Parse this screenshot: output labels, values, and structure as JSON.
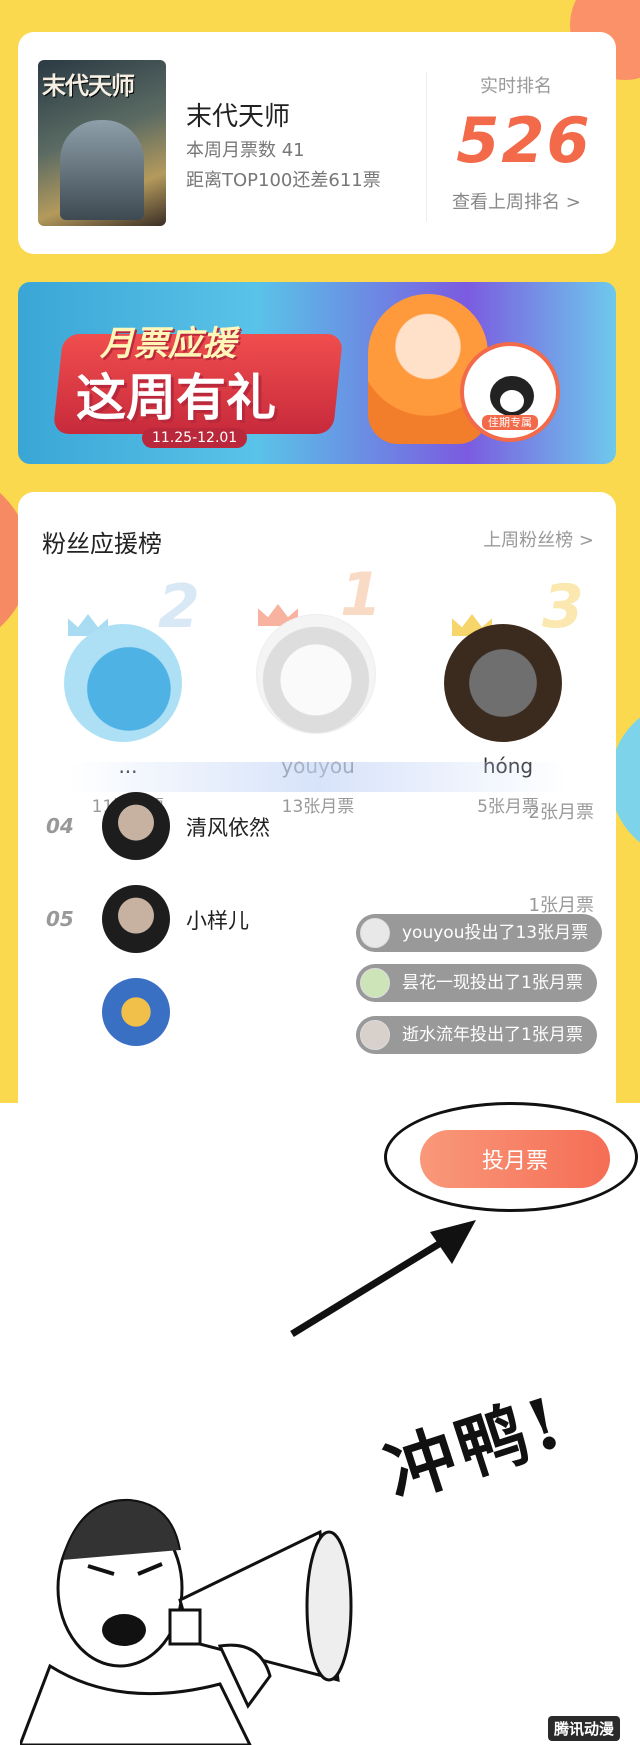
{
  "rank_card": {
    "comic_title": "末代天师",
    "weekly_votes": "本周月票数 41",
    "gap_text": "距离TOP100还差611票",
    "realtime_label": "实时排名",
    "rank_number": "526",
    "last_week_link": "查看上周排名 >",
    "cover_title": "末代天师"
  },
  "banner": {
    "line1": "月票应援",
    "line2": "这周有礼",
    "date_range": "11.25-12.01",
    "badge_text": "佳期专属"
  },
  "fan_board": {
    "title": "粉丝应援榜",
    "last_week_link": "上周粉丝榜 >",
    "podium": [
      {
        "rank": "2",
        "name": "...",
        "votes": "11张月票"
      },
      {
        "rank": "1",
        "name": "youyou",
        "votes": "13张月票"
      },
      {
        "rank": "3",
        "name": "hóng",
        "votes": "5张月票"
      }
    ],
    "list": [
      {
        "rank": "04",
        "name": "清风依然",
        "votes": "2张月票"
      },
      {
        "rank": "05",
        "name": "小样儿",
        "votes": "1张月票"
      }
    ]
  },
  "danmaku": [
    "youyou投出了13张月票",
    "昙花一现投出了1张月票",
    "逝水流年投出了1张月票"
  ],
  "vote_button": "投月票",
  "meme": {
    "text": "冲鸭!",
    "watermark": "腾讯动漫"
  },
  "colors": {
    "background_yellow": "#fbd94f",
    "rank_accent": "#f26a4a",
    "vote_button": "#f56d55"
  }
}
